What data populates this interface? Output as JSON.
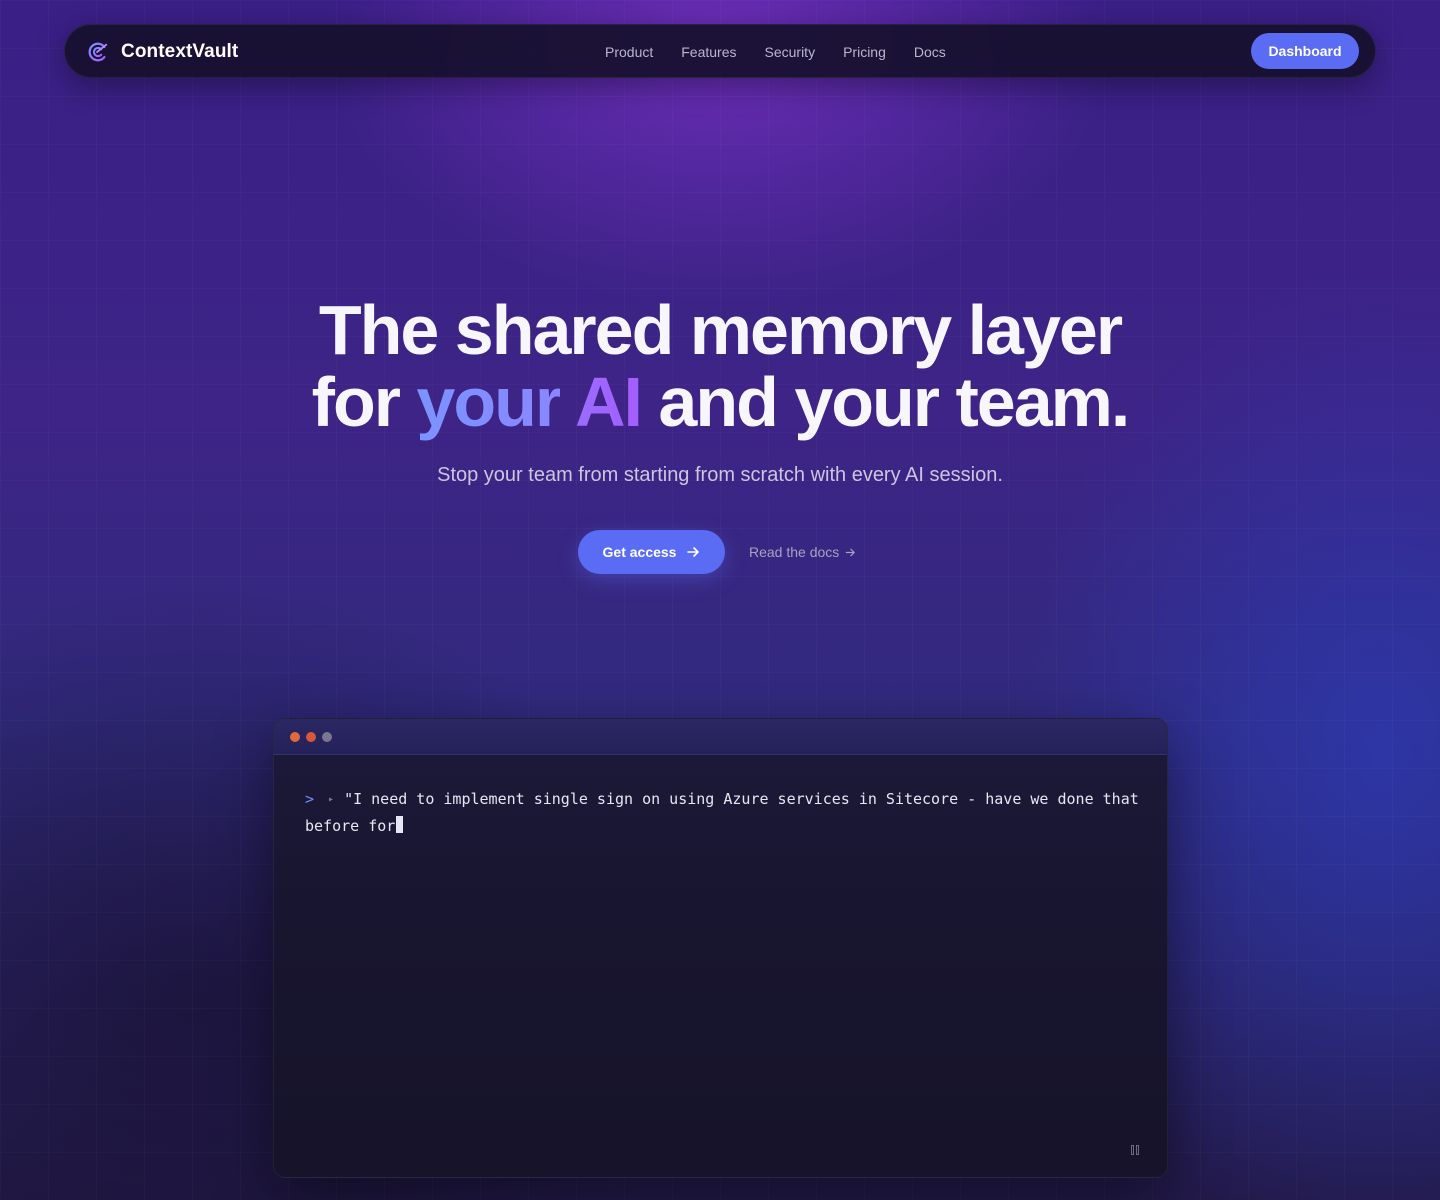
{
  "nav": {
    "brand": "ContextVault",
    "links": [
      "Product",
      "Features",
      "Security",
      "Pricing",
      "Docs"
    ],
    "dashboard_label": "Dashboard"
  },
  "hero": {
    "title_line1": "The shared memory layer",
    "title_for": "for ",
    "title_your": "your",
    "title_ai": "AI",
    "title_rest": " and your team.",
    "subtitle": "Stop your team from starting from scratch with every AI session.",
    "cta_primary": "Get access",
    "cta_secondary": "Read the docs"
  },
  "terminal": {
    "prompt_symbol": ">",
    "input_text": "\"I need to implement single sign on using Azure services in Sitecore - have we done that before for",
    "window_dots": [
      "#e0693e",
      "#d9583a",
      "#7a7890"
    ]
  },
  "colors": {
    "accent": "#5a6cf3",
    "accent_gradient_start": "#7b93ff",
    "accent_gradient_end": "#a45dff"
  },
  "icons": {
    "brand_logo": "contextvault-logo-icon",
    "cta_arrow": "arrow-right-icon",
    "docs_arrow": "arrow-right-icon",
    "terminal_pause": "pause-icon"
  }
}
